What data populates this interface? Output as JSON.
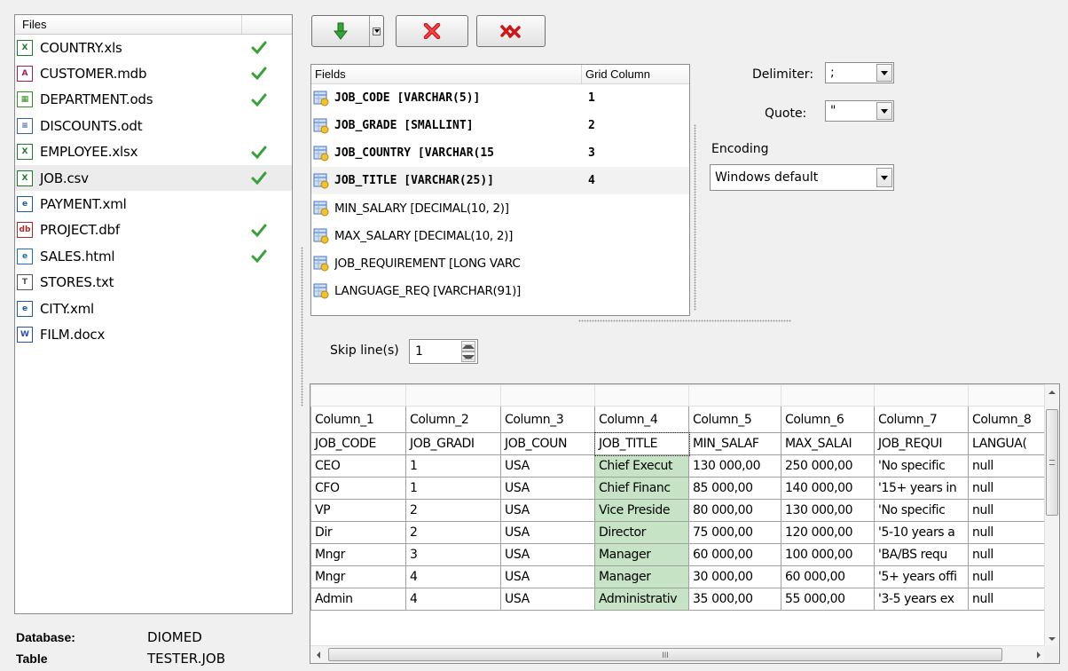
{
  "files_panel": {
    "header": "Files",
    "items": [
      {
        "name": "COUNTRY.xls",
        "type": "xls",
        "checked": true
      },
      {
        "name": "CUSTOMER.mdb",
        "type": "mdb",
        "checked": true
      },
      {
        "name": "DEPARTMENT.ods",
        "type": "ods",
        "checked": true
      },
      {
        "name": "DISCOUNTS.odt",
        "type": "odt",
        "checked": false
      },
      {
        "name": "EMPLOYEE.xlsx",
        "type": "xlsx",
        "checked": true
      },
      {
        "name": "JOB.csv",
        "type": "csv",
        "checked": true,
        "selected": true
      },
      {
        "name": "PAYMENT.xml",
        "type": "xml",
        "checked": false
      },
      {
        "name": "PROJECT.dbf",
        "type": "dbf",
        "checked": true
      },
      {
        "name": "SALES.html",
        "type": "html",
        "checked": true
      },
      {
        "name": "STORES.txt",
        "type": "txt",
        "checked": false
      },
      {
        "name": "CITY.xml",
        "type": "xml",
        "checked": false
      },
      {
        "name": "FILM.docx",
        "type": "docx",
        "checked": false
      }
    ]
  },
  "info": {
    "database_label": "Database:",
    "database_value": "DIOMED",
    "table_label": "Table",
    "table_value": "TESTER.JOB"
  },
  "toolbar": {
    "add_icon": "green-down-arrow-icon",
    "remove_icon": "red-x-icon",
    "remove_all_icon": "red-double-x-icon"
  },
  "fields": {
    "header_fields": "Fields",
    "header_grid_column": "Grid Column",
    "items": [
      {
        "name": "JOB_CODE [VARCHAR(5)]",
        "grid": "1",
        "mapped": true
      },
      {
        "name": "JOB_GRADE [SMALLINT]",
        "grid": "2",
        "mapped": true
      },
      {
        "name": "JOB_COUNTRY [VARCHAR(15",
        "grid": "3",
        "mapped": true
      },
      {
        "name": "JOB_TITLE [VARCHAR(25)]",
        "grid": "4",
        "mapped": true
      },
      {
        "name": "MIN_SALARY  [DECIMAL(10, 2)]",
        "grid": "",
        "mapped": false
      },
      {
        "name": "MAX_SALARY  [DECIMAL(10, 2)]",
        "grid": "",
        "mapped": false
      },
      {
        "name": "JOB_REQUIREMENT  [LONG VARC",
        "grid": "",
        "mapped": false
      },
      {
        "name": "LANGUAGE_REQ  [VARCHAR(91)]",
        "grid": "",
        "mapped": false
      }
    ]
  },
  "options": {
    "delimiter_label": "Delimiter:",
    "delimiter_value": ";",
    "quote_label": "Quote:",
    "quote_value": "\"",
    "encoding_label": "Encoding",
    "encoding_value": "Windows default",
    "skip_label": "Skip line(s)",
    "skip_value": "1"
  },
  "grid": {
    "columns": [
      "Column_1",
      "Column_2",
      "Column_3",
      "Column_4",
      "Column_5",
      "Column_6",
      "Column_7",
      "Column_8"
    ],
    "rows": [
      [
        "JOB_CODE",
        "JOB_GRADI",
        "JOB_COUN",
        "JOB_TITLE",
        "MIN_SALAF",
        "MAX_SALAI",
        "JOB_REQUI",
        "LANGUA("
      ],
      [
        "CEO",
        "1",
        "USA",
        "Chief Execut",
        "130 000,00",
        "250 000,00",
        "'No specific",
        "null"
      ],
      [
        "CFO",
        "1",
        "USA",
        "Chief Financ",
        "85 000,00",
        "140 000,00",
        "'15+ years in",
        "null"
      ],
      [
        "VP",
        "2",
        "USA",
        "Vice Preside",
        "80 000,00",
        "130 000,00",
        "'No specific",
        "null"
      ],
      [
        "Dir",
        "2",
        "USA",
        "Director",
        "75 000,00",
        "120 000,00",
        "'5-10 years a",
        "null"
      ],
      [
        "Mngr",
        "3",
        "USA",
        "Manager",
        "60 000,00",
        "100 000,00",
        "'BA/BS requ",
        "null"
      ],
      [
        "Mngr",
        "4",
        "USA",
        "Manager",
        "30 000,00",
        "60 000,00",
        "'5+ years offi",
        "null"
      ],
      [
        "Admin",
        "4",
        "USA",
        "Administrativ",
        "35 000,00",
        "55 000,00",
        "'3-5 years ex",
        "null"
      ]
    ],
    "scroll_mid_glyph": "III"
  }
}
